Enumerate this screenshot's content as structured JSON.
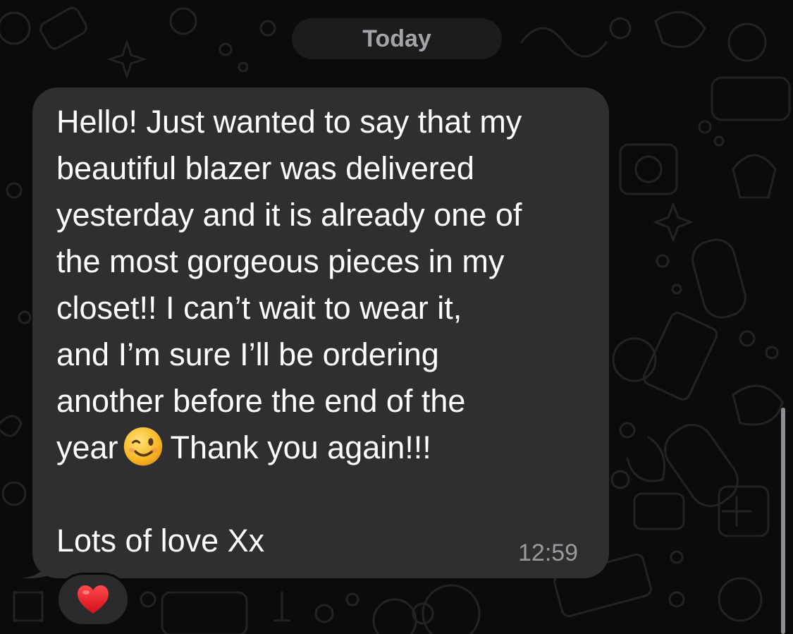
{
  "chat": {
    "date_label": "Today",
    "message": {
      "body_line1": "Hello! Just wanted to say that my",
      "body_line2": "beautiful blazer was delivered",
      "body_line3": "yesterday and it is already one of",
      "body_line4": "the most gorgeous pieces in my",
      "body_line5": "closet!! I can’t wait to wear it,",
      "body_line6": "and I’m sure I’ll be ordering",
      "body_line7": "another before the end of the",
      "body_line8_start": "year",
      "body_line8_end": "Thank you again!!!",
      "emoji": "winking-face-emoji",
      "signoff": "Lots of love Xx",
      "time": "12:59",
      "reaction": "red-heart-emoji"
    }
  },
  "colors": {
    "background": "#0b0b0b",
    "bubble": "#2f2f31",
    "text": "#ffffff",
    "muted": "#9a9a9f"
  }
}
